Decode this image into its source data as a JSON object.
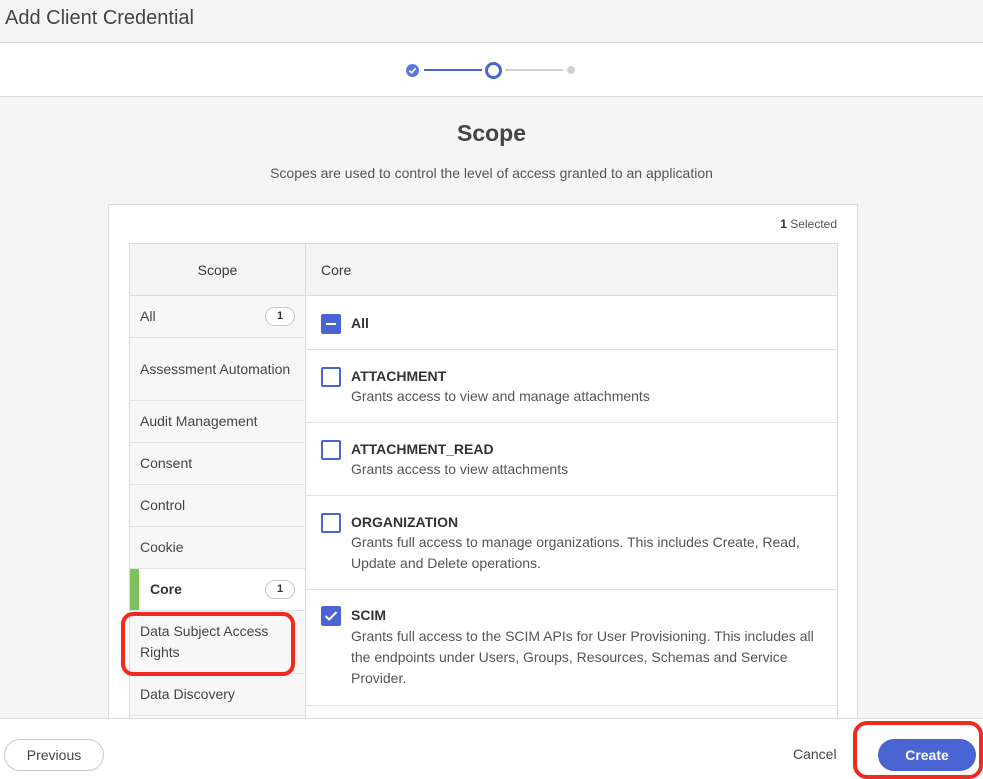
{
  "header": {
    "title": "Add Client Credential"
  },
  "page": {
    "title": "Scope",
    "subtitle": "Scopes are used to control the level of access granted to an application"
  },
  "selection": {
    "count": "1",
    "label": "Selected"
  },
  "left": {
    "header": "Scope",
    "items": [
      {
        "label": "All",
        "badge": "1"
      },
      {
        "label": "Assessment Automation"
      },
      {
        "label": "Audit Management"
      },
      {
        "label": "Consent"
      },
      {
        "label": "Control"
      },
      {
        "label": "Cookie"
      },
      {
        "label": "Core",
        "badge": "1",
        "active": true
      },
      {
        "label": "Data Subject Access Rights"
      },
      {
        "label": "Data Discovery"
      }
    ]
  },
  "right": {
    "header": "Core",
    "all_label": "All",
    "scopes": [
      {
        "name": "ATTACHMENT",
        "description": "Grants access to view and manage attachments",
        "checked": false
      },
      {
        "name": "ATTACHMENT_READ",
        "description": "Grants access to view attachments",
        "checked": false
      },
      {
        "name": "ORGANIZATION",
        "description": "Grants full access to manage organizations. This includes Create, Read, Update and Delete operations.",
        "checked": false
      },
      {
        "name": "SCIM",
        "description": "Grants full access to the SCIM APIs for User Provisioning. This includes all the endpoints under Users, Groups, Resources, Schemas and Service Provider.",
        "checked": true
      }
    ]
  },
  "footer": {
    "previous": "Previous",
    "cancel": "Cancel",
    "create": "Create"
  },
  "colors": {
    "accent": "#4a64d3",
    "active_marker": "#7dc35b",
    "highlight": "#f02b1d"
  }
}
